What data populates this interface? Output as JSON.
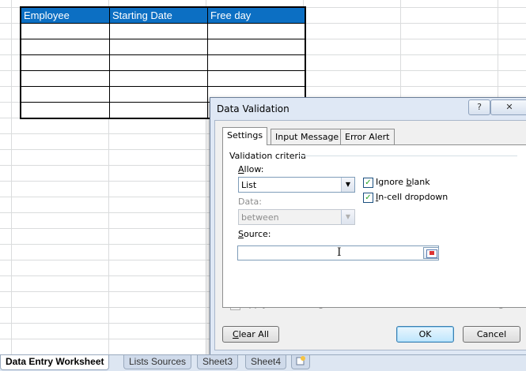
{
  "sheet": {
    "headers": [
      "Employee",
      "Starting Date",
      "Free day"
    ],
    "empty_rows": 6,
    "header_color": "#0c6fc3"
  },
  "dialog": {
    "title": "Data Validation",
    "help_label": "?",
    "close_label": "✕",
    "tabs": {
      "settings": "Settings",
      "input_message": "Input Message",
      "error_alert": "Error Alert"
    },
    "group_label": "Validation criteria",
    "allow": {
      "label_first": "A",
      "label_rest": "llow:",
      "value": "List"
    },
    "ignore_blank": {
      "label_first": "Ignore ",
      "label_ul": "b",
      "label_rest": "lank",
      "checked": true
    },
    "in_cell_dropdown": {
      "label_first": "",
      "label_ul": "I",
      "label_rest": "n-cell dropdown",
      "checked": true
    },
    "data": {
      "label": "Data:",
      "value": "between"
    },
    "source": {
      "label_first": "S",
      "label_rest": "ource:",
      "value": ""
    },
    "apply_all": {
      "label": "Apply these changes to all other cells with the same settings",
      "checked": false
    },
    "buttons": {
      "clear_ul": "C",
      "clear_rest": "lear All",
      "ok": "OK",
      "cancel": "Cancel"
    }
  },
  "sheet_tabs": [
    "Data Entry Worksheet",
    "Lists Sources",
    "Sheet3",
    "Sheet4"
  ],
  "icons": {
    "new_sheet": "insert-sheet-icon",
    "dropdown": "chevron-down-icon",
    "range_ref": "range-selector-icon",
    "cursor": "text-cursor-icon"
  }
}
